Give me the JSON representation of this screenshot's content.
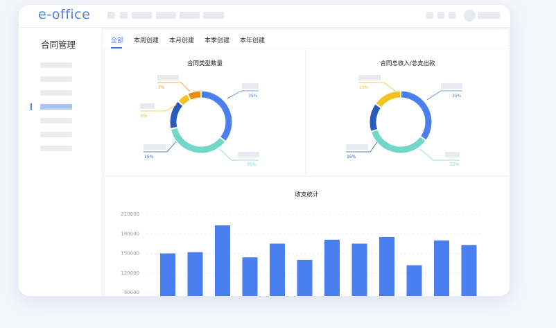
{
  "app": {
    "logo": "e-office"
  },
  "sidebar": {
    "title": "合同管理"
  },
  "tabs": [
    {
      "label": "全部",
      "active": true
    },
    {
      "label": "本周创建"
    },
    {
      "label": "本月创建"
    },
    {
      "label": "本季创建"
    },
    {
      "label": "本年创建"
    }
  ],
  "colors": {
    "accent": "#4a7ff0",
    "teal": "#72d6c8",
    "navy": "#2a5bb8",
    "yellow": "#f2c31f",
    "orange": "#f08c0c"
  },
  "chart_data": [
    {
      "type": "pie",
      "title": "合同类型数量",
      "labels": [
        "35%",
        "35%",
        "15%",
        "6%",
        "7%"
      ],
      "values": [
        35,
        35,
        15,
        6,
        7
      ]
    },
    {
      "type": "pie",
      "title": "合同总收入/总支出款",
      "labels": [
        "35%",
        "35%",
        "15%",
        "15%"
      ],
      "values": [
        35,
        35,
        15,
        15
      ]
    },
    {
      "type": "bar",
      "title": "收支统计",
      "yticks": [
        "210000",
        "180000",
        "150000",
        "120000",
        "90000"
      ],
      "ylim": [
        90000,
        210000
      ],
      "values": [
        150000,
        152000,
        193000,
        144000,
        165000,
        140000,
        171000,
        165000,
        175000,
        132000,
        170000,
        163000
      ],
      "grid": true
    }
  ]
}
